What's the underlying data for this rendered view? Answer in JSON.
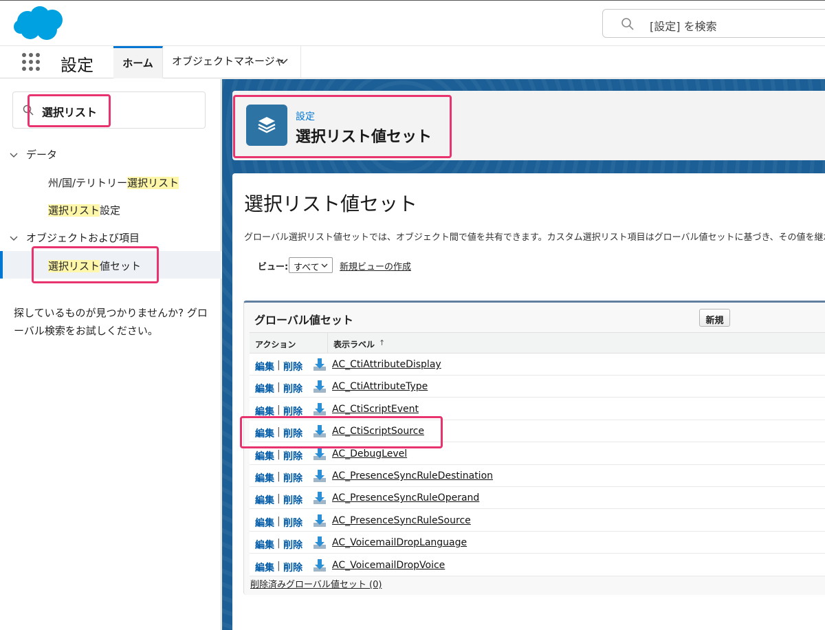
{
  "header": {
    "search_placeholder": "[設定] を検索"
  },
  "nav": {
    "app_name": "設定",
    "tabs": [
      {
        "label": "ホーム"
      },
      {
        "label": "オブジェクトマネージャ"
      }
    ]
  },
  "sidebar": {
    "search_value": "選択リスト",
    "groups": [
      {
        "label": "データ",
        "items": [
          {
            "prefix": "州/国/テリトリー",
            "match": "選択リスト",
            "suffix": ""
          },
          {
            "prefix": "",
            "match": "選択リスト",
            "suffix": "設定"
          }
        ]
      },
      {
        "label": "オブジェクトおよび項目",
        "items": [
          {
            "prefix": "",
            "match": "選択リスト",
            "suffix": "値セット"
          }
        ]
      }
    ],
    "help_text": "探しているものが見つかりませんか? グローバル検索をお試しください。"
  },
  "page_header": {
    "breadcrumb": "設定",
    "title": "選択リスト値セット"
  },
  "content": {
    "title": "選択リスト値セット",
    "description": "グローバル選択リスト値セットでは、オブジェクト間で値を共有できます。カスタム選択リスト項目はグローバル値セットに基づき、その値を継承",
    "view_label": "ビュー:",
    "view_value": "すべて",
    "new_view_link": "新規ビューの作成"
  },
  "list": {
    "title": "グローバル値セット",
    "new_button": "新規",
    "columns": {
      "action": "アクション",
      "label": "表示ラベル",
      "sort_indicator": "↑"
    },
    "edit_label": "編集",
    "separator": "|",
    "delete_label": "削除",
    "rows": [
      {
        "name": "AC_CtiAttributeDisplay"
      },
      {
        "name": "AC_CtiAttributeType"
      },
      {
        "name": "AC_CtiScriptEvent"
      },
      {
        "name": "AC_CtiScriptSource"
      },
      {
        "name": "AC_DebugLevel"
      },
      {
        "name": "AC_PresenceSyncRuleDestination"
      },
      {
        "name": "AC_PresenceSyncRuleOperand"
      },
      {
        "name": "AC_PresenceSyncRuleSource"
      },
      {
        "name": "AC_VoicemailDropLanguage"
      },
      {
        "name": "AC_VoicemailDropVoice"
      }
    ],
    "deleted_link": "削除済みグローバル値セット (0)"
  },
  "colors": {
    "brand": "#00a1e0",
    "link": "#015ba7",
    "highlight_box": "#e8336e",
    "match_highlight": "#fef6a9"
  }
}
